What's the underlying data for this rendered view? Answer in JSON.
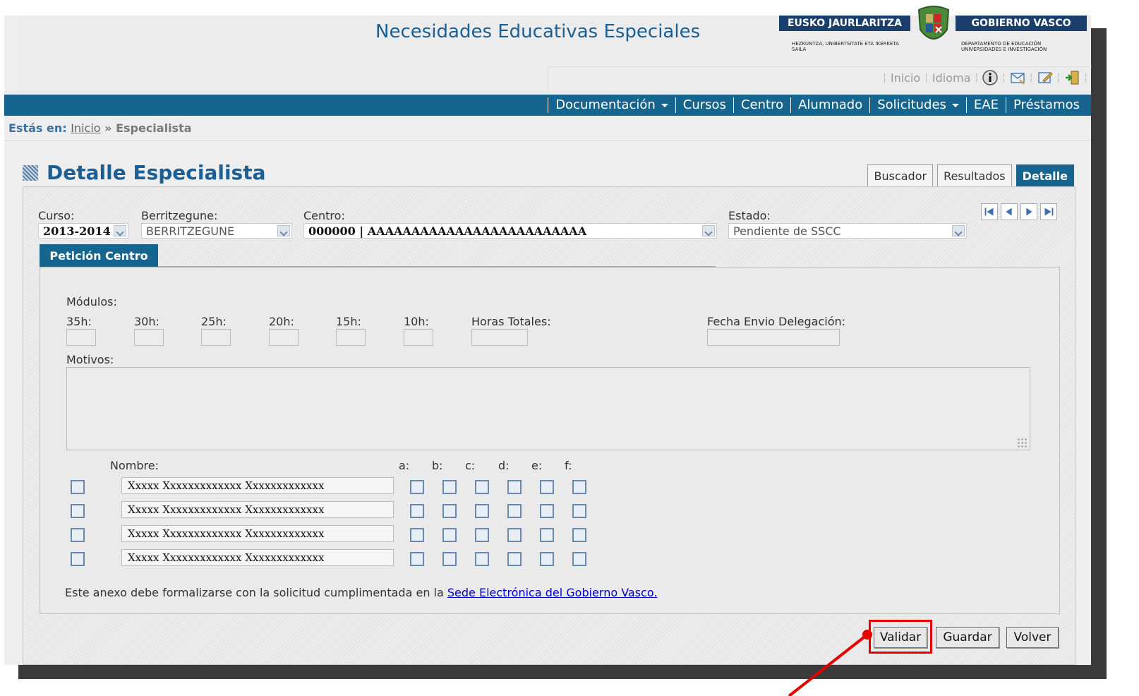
{
  "app": {
    "title": "Necesidades Educativas Especiales"
  },
  "gov": {
    "left_label": "EUSKO JAURLARITZA",
    "right_label": "GOBIERNO VASCO",
    "left_sub": "HEZKUNTZA, UNIBERTSITATE ETA IKERKETA SAILA",
    "right_sub": "DEPARTAMENTO DE EDUCACIÓN UNIVERSIDADES E INVESTIGACIÓN"
  },
  "util": {
    "inicio": "Inicio",
    "idioma": "Idioma"
  },
  "nav": {
    "items": [
      "Documentación",
      "Cursos",
      "Centro",
      "Alumnado",
      "Solicitudes",
      "EAE",
      "Préstamos"
    ]
  },
  "breadcrumb": {
    "label": "Estás en:",
    "home": "Inicio",
    "sep": "»",
    "current": "Especialista"
  },
  "page": {
    "title": "Detalle Especialista"
  },
  "tabs": {
    "buscador": "Buscador",
    "resultados": "Resultados",
    "detalle": "Detalle"
  },
  "filters": {
    "curso_label": "Curso:",
    "curso_value": "2013-2014",
    "berritzegune_label": "Berritzegune:",
    "berritzegune_value": "BERRITZEGUNE",
    "centro_label": "Centro:",
    "centro_value": "000000 | AAAAAAAAAAAAAAAAAAAAAAAAA",
    "estado_label": "Estado:",
    "estado_value": "Pendiente de SSCC"
  },
  "section_tab": "Petición Centro",
  "form": {
    "modulos_label": "Módulos:",
    "h35": "35h:",
    "h30": "30h:",
    "h25": "25h:",
    "h20": "20h:",
    "h15": "15h:",
    "h10": "10h:",
    "horas_totales": "Horas Totales:",
    "fecha_envio": "Fecha Envio Delegación:",
    "motivos": "Motivos:",
    "nombre": "Nombre:",
    "cols": [
      "a:",
      "b:",
      "c:",
      "d:",
      "e:",
      "f:"
    ]
  },
  "rows": [
    {
      "nombre": "Xxxxx Xxxxxxxxxxxxx Xxxxxxxxxxxxx"
    },
    {
      "nombre": "Xxxxx Xxxxxxxxxxxxx Xxxxxxxxxxxxx"
    },
    {
      "nombre": "Xxxxx Xxxxxxxxxxxxx Xxxxxxxxxxxxx"
    },
    {
      "nombre": "Xxxxx Xxxxxxxxxxxxx Xxxxxxxxxxxxx"
    }
  ],
  "note": {
    "text": "Este anexo debe formalizarse con la solicitud cumplimentada en la",
    "link": "Sede Electrónica del Gobierno Vasco."
  },
  "buttons": {
    "validar": "Validar",
    "guardar": "Guardar",
    "volver": "Volver"
  },
  "colors": {
    "brand": "#16658f",
    "title": "#1a5f96",
    "highlight": "#e60000"
  }
}
